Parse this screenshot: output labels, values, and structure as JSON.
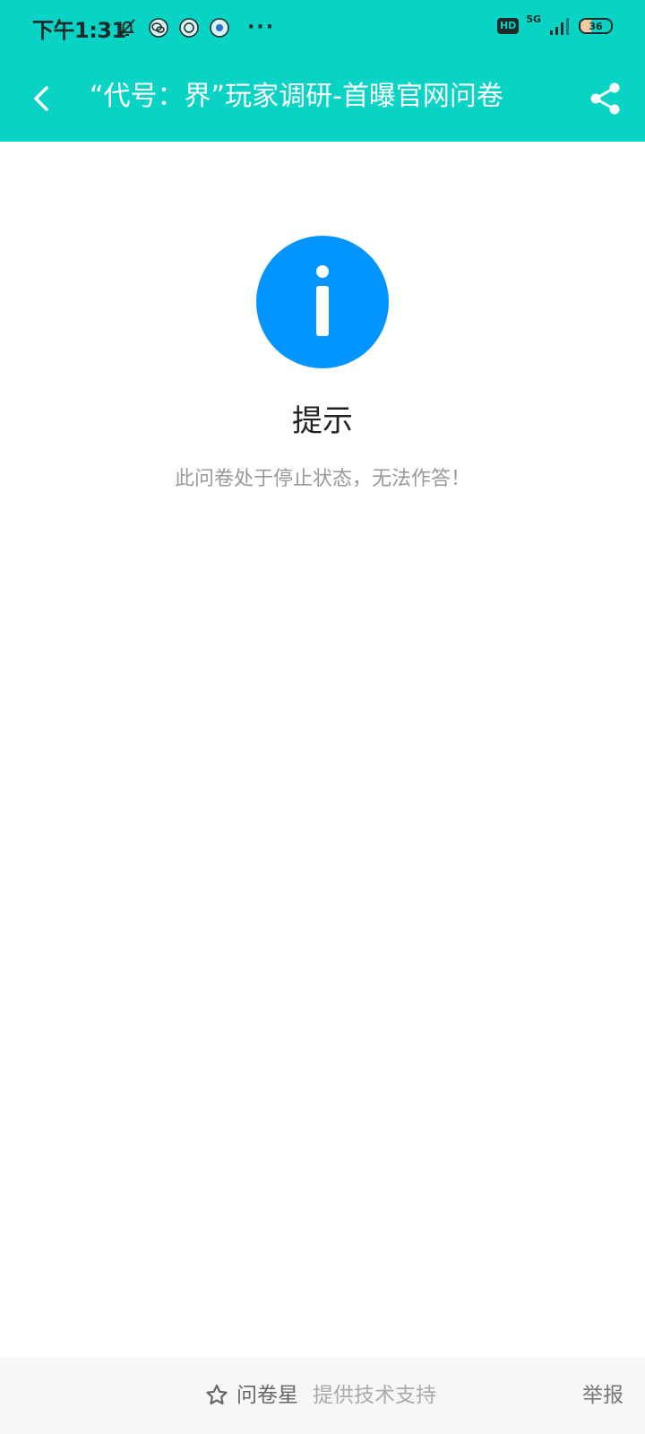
{
  "status_bar": {
    "time": "下午1:31",
    "hd_label": "HD",
    "network_label": "5G",
    "battery_level": "36",
    "more_indicator": "···"
  },
  "header": {
    "title": "“代号：界”玩家调研-首曝官网问卷"
  },
  "notice": {
    "title": "提示",
    "message": "此问卷处于停止状态，无法作答！"
  },
  "footer": {
    "brand_name": "问卷星",
    "brand_support": "提供技术支持",
    "report_label": "举报"
  },
  "colors": {
    "header_bg": "#08d3c4",
    "info_icon_bg": "#0395ff"
  }
}
